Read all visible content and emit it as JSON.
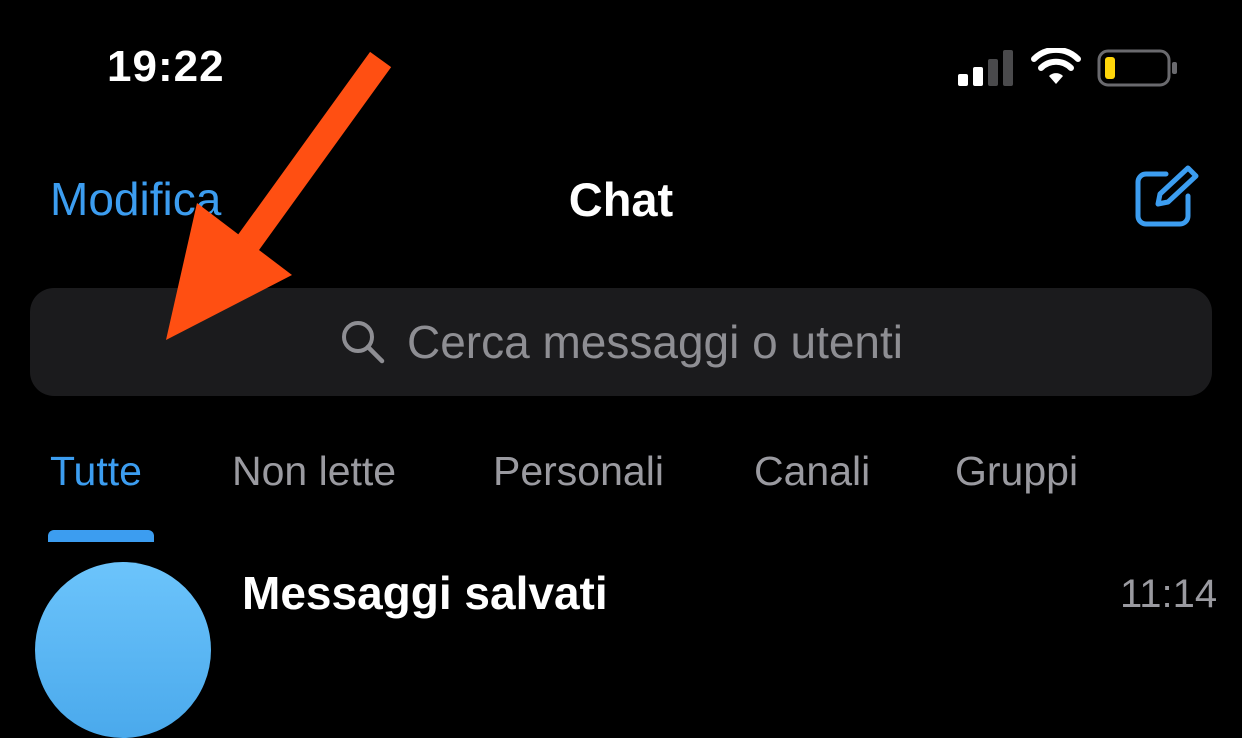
{
  "status_bar": {
    "time": "19:22",
    "icons": [
      "signal-icon",
      "wifi-icon",
      "battery-icon"
    ],
    "battery_color": "#ffd60a"
  },
  "nav": {
    "edit_label": "Modifica",
    "title": "Chat",
    "compose_icon": "compose-icon"
  },
  "search": {
    "placeholder": "Cerca messaggi o utenti",
    "icon": "search-icon"
  },
  "tabs": [
    {
      "label": "Tutte",
      "active": true
    },
    {
      "label": "Non lette",
      "active": false
    },
    {
      "label": "Personali",
      "active": false
    },
    {
      "label": "Canali",
      "active": false
    },
    {
      "label": "Gruppi",
      "active": false
    }
  ],
  "chats": [
    {
      "name": "Messaggi salvati",
      "time": "11:14"
    }
  ],
  "annotation": {
    "icon": "arrow-icon",
    "color": "#ff4f12"
  },
  "colors": {
    "accent": "#3c9df0",
    "background": "#000000",
    "search_bg": "#1b1b1d",
    "secondary_text": "#9a9aa0"
  }
}
